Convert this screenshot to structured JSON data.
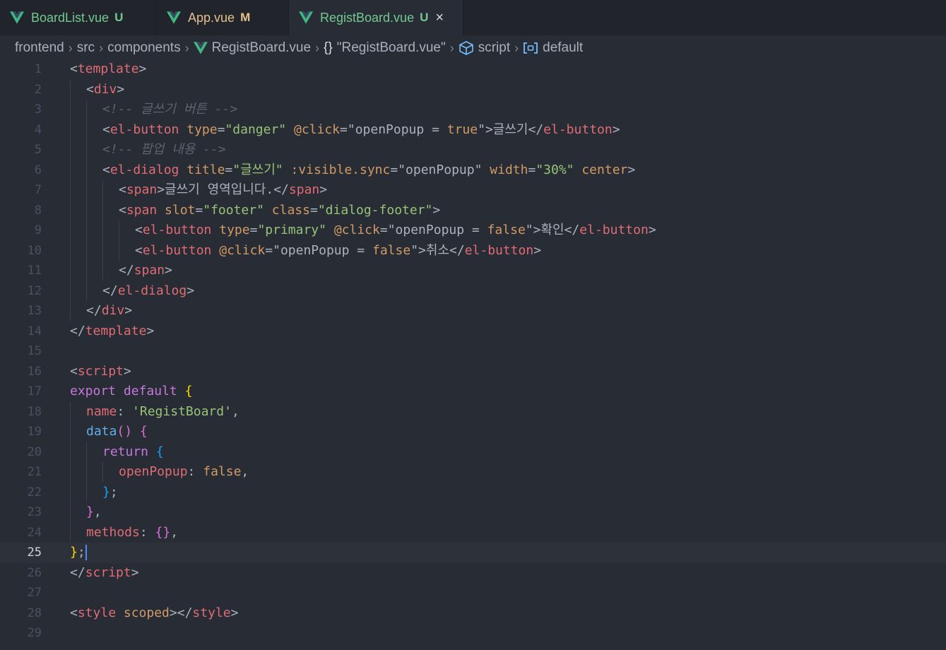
{
  "tabs": [
    {
      "name": "tab-boardlist",
      "label": "BoardList.vue",
      "status": "U",
      "label_color": "#73c991",
      "status_color": "#73c991",
      "active": false
    },
    {
      "name": "tab-app",
      "label": "App.vue",
      "status": "M",
      "label_color": "#e2c08d",
      "status_color": "#e2c08d",
      "active": false
    },
    {
      "name": "tab-registboard",
      "label": "RegistBoard.vue",
      "status": "U",
      "label_color": "#73c991",
      "status_color": "#73c991",
      "active": true,
      "close_icon": "×"
    }
  ],
  "breadcrumb": {
    "items": [
      "frontend",
      "src",
      "components",
      "RegistBoard.vue",
      "\"RegistBoard.vue\"",
      "script",
      "default"
    ],
    "icons": [
      "",
      "",
      "",
      "vue-icon",
      "braces-icon",
      "cube-icon",
      "symbol-field-icon"
    ],
    "separator": "›",
    "braces_glyph": "{}"
  },
  "editor": {
    "current_line": 25,
    "lines": [
      {
        "n": "1",
        "indent": 0,
        "tokens": [
          [
            "punc",
            "<"
          ],
          [
            "tag",
            "template"
          ],
          [
            "punc",
            ">"
          ]
        ]
      },
      {
        "n": "2",
        "indent": 1,
        "tokens": [
          [
            "punc",
            "<"
          ],
          [
            "tag",
            "div"
          ],
          [
            "punc",
            ">"
          ]
        ]
      },
      {
        "n": "3",
        "indent": 2,
        "tokens": [
          [
            "cmt",
            "<!-- 글쓰기 버튼 -->"
          ]
        ]
      },
      {
        "n": "4",
        "indent": 2,
        "tokens": [
          [
            "punc",
            "<"
          ],
          [
            "tag",
            "el-button"
          ],
          [
            "text",
            " "
          ],
          [
            "attr",
            "type"
          ],
          [
            "punc",
            "="
          ],
          [
            "str",
            "\"danger\""
          ],
          [
            "text",
            " "
          ],
          [
            "attr",
            "@click"
          ],
          [
            "punc",
            "=\""
          ],
          [
            "text",
            "openPopup = "
          ],
          [
            "bool",
            "true"
          ],
          [
            "punc",
            "\">"
          ],
          [
            "text",
            "글쓰기"
          ],
          [
            "punc",
            "</"
          ],
          [
            "tag",
            "el-button"
          ],
          [
            "punc",
            ">"
          ]
        ]
      },
      {
        "n": "5",
        "indent": 2,
        "tokens": [
          [
            "cmt",
            "<!-- 팝업 내용 -->"
          ]
        ]
      },
      {
        "n": "6",
        "indent": 2,
        "tokens": [
          [
            "punc",
            "<"
          ],
          [
            "tag",
            "el-dialog"
          ],
          [
            "text",
            " "
          ],
          [
            "attr",
            "title"
          ],
          [
            "punc",
            "="
          ],
          [
            "str",
            "\"글쓰기\""
          ],
          [
            "text",
            " "
          ],
          [
            "attr",
            ":visible.sync"
          ],
          [
            "punc",
            "=\""
          ],
          [
            "text",
            "openPopup"
          ],
          [
            "punc",
            "\""
          ],
          [
            "text",
            " "
          ],
          [
            "attr",
            "width"
          ],
          [
            "punc",
            "="
          ],
          [
            "str",
            "\"30%\""
          ],
          [
            "text",
            " "
          ],
          [
            "attr",
            "center"
          ],
          [
            "punc",
            ">"
          ]
        ]
      },
      {
        "n": "7",
        "indent": 3,
        "tokens": [
          [
            "punc",
            "<"
          ],
          [
            "tag",
            "span"
          ],
          [
            "punc",
            ">"
          ],
          [
            "text",
            "글쓰기 영역입니다."
          ],
          [
            "punc",
            "</"
          ],
          [
            "tag",
            "span"
          ],
          [
            "punc",
            ">"
          ]
        ]
      },
      {
        "n": "8",
        "indent": 3,
        "tokens": [
          [
            "punc",
            "<"
          ],
          [
            "tag",
            "span"
          ],
          [
            "text",
            " "
          ],
          [
            "attr",
            "slot"
          ],
          [
            "punc",
            "="
          ],
          [
            "str",
            "\"footer\""
          ],
          [
            "text",
            " "
          ],
          [
            "attr",
            "class"
          ],
          [
            "punc",
            "="
          ],
          [
            "str",
            "\"dialog-footer\""
          ],
          [
            "punc",
            ">"
          ]
        ]
      },
      {
        "n": "9",
        "indent": 4,
        "tokens": [
          [
            "punc",
            "<"
          ],
          [
            "tag",
            "el-button"
          ],
          [
            "text",
            " "
          ],
          [
            "attr",
            "type"
          ],
          [
            "punc",
            "="
          ],
          [
            "str",
            "\"primary\""
          ],
          [
            "text",
            " "
          ],
          [
            "attr",
            "@click"
          ],
          [
            "punc",
            "=\""
          ],
          [
            "text",
            "openPopup = "
          ],
          [
            "bool",
            "false"
          ],
          [
            "punc",
            "\">"
          ],
          [
            "text",
            "확인"
          ],
          [
            "punc",
            "</"
          ],
          [
            "tag",
            "el-button"
          ],
          [
            "punc",
            ">"
          ]
        ]
      },
      {
        "n": "10",
        "indent": 4,
        "tokens": [
          [
            "punc",
            "<"
          ],
          [
            "tag",
            "el-button"
          ],
          [
            "text",
            " "
          ],
          [
            "attr",
            "@click"
          ],
          [
            "punc",
            "=\""
          ],
          [
            "text",
            "openPopup = "
          ],
          [
            "bool",
            "false"
          ],
          [
            "punc",
            "\">"
          ],
          [
            "text",
            "취소"
          ],
          [
            "punc",
            "</"
          ],
          [
            "tag",
            "el-button"
          ],
          [
            "punc",
            ">"
          ]
        ]
      },
      {
        "n": "11",
        "indent": 3,
        "tokens": [
          [
            "punc",
            "</"
          ],
          [
            "tag",
            "span"
          ],
          [
            "punc",
            ">"
          ]
        ]
      },
      {
        "n": "12",
        "indent": 2,
        "tokens": [
          [
            "punc",
            "</"
          ],
          [
            "tag",
            "el-dialog"
          ],
          [
            "punc",
            ">"
          ]
        ]
      },
      {
        "n": "13",
        "indent": 1,
        "tokens": [
          [
            "punc",
            "</"
          ],
          [
            "tag",
            "div"
          ],
          [
            "punc",
            ">"
          ]
        ]
      },
      {
        "n": "14",
        "indent": 0,
        "tokens": [
          [
            "punc",
            "</"
          ],
          [
            "tag",
            "template"
          ],
          [
            "punc",
            ">"
          ]
        ]
      },
      {
        "n": "15",
        "indent": 0,
        "tokens": []
      },
      {
        "n": "16",
        "indent": 0,
        "tokens": [
          [
            "punc",
            "<"
          ],
          [
            "tag",
            "script"
          ],
          [
            "punc",
            ">"
          ]
        ]
      },
      {
        "n": "17",
        "indent": 0,
        "tokens": [
          [
            "kw",
            "export"
          ],
          [
            "text",
            " "
          ],
          [
            "kw",
            "default"
          ],
          [
            "text",
            " "
          ],
          [
            "br1",
            "{"
          ]
        ]
      },
      {
        "n": "18",
        "indent": 1,
        "tokens": [
          [
            "prop",
            "name"
          ],
          [
            "punc",
            ": "
          ],
          [
            "str",
            "'RegistBoard'"
          ],
          [
            "punc",
            ","
          ]
        ]
      },
      {
        "n": "19",
        "indent": 1,
        "tokens": [
          [
            "fn",
            "data"
          ],
          [
            "br2",
            "()"
          ],
          [
            "text",
            " "
          ],
          [
            "br2",
            "{"
          ]
        ]
      },
      {
        "n": "20",
        "indent": 2,
        "tokens": [
          [
            "kw",
            "return"
          ],
          [
            "text",
            " "
          ],
          [
            "br3",
            "{"
          ]
        ]
      },
      {
        "n": "21",
        "indent": 3,
        "tokens": [
          [
            "prop",
            "openPopup"
          ],
          [
            "punc",
            ": "
          ],
          [
            "bool",
            "false"
          ],
          [
            "punc",
            ","
          ]
        ]
      },
      {
        "n": "22",
        "indent": 2,
        "tokens": [
          [
            "br3",
            "}"
          ],
          [
            "punc",
            ";"
          ]
        ]
      },
      {
        "n": "23",
        "indent": 1,
        "tokens": [
          [
            "br2",
            "}"
          ],
          [
            "punc",
            ","
          ]
        ]
      },
      {
        "n": "24",
        "indent": 1,
        "tokens": [
          [
            "prop",
            "methods"
          ],
          [
            "punc",
            ": "
          ],
          [
            "br2",
            "{}"
          ],
          [
            "punc",
            ","
          ]
        ]
      },
      {
        "n": "25",
        "indent": 0,
        "tokens": [
          [
            "br1",
            "}"
          ],
          [
            "punc",
            ";"
          ]
        ],
        "cursor": true
      },
      {
        "n": "26",
        "indent": 0,
        "tokens": [
          [
            "punc",
            "</"
          ],
          [
            "tag",
            "script"
          ],
          [
            "punc",
            ">"
          ]
        ]
      },
      {
        "n": "27",
        "indent": 0,
        "tokens": []
      },
      {
        "n": "28",
        "indent": 0,
        "tokens": [
          [
            "punc",
            "<"
          ],
          [
            "tag",
            "style"
          ],
          [
            "text",
            " "
          ],
          [
            "attr",
            "scoped"
          ],
          [
            "punc",
            "></"
          ],
          [
            "tag",
            "style"
          ],
          [
            "punc",
            ">"
          ]
        ]
      },
      {
        "n": "29",
        "indent": 0,
        "tokens": []
      }
    ]
  }
}
